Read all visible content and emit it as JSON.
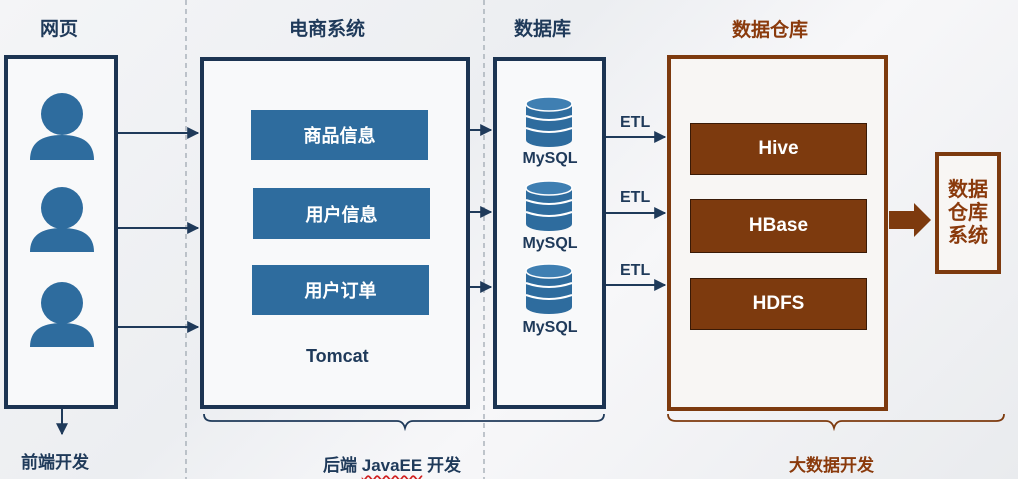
{
  "headings": {
    "webpage": "网页",
    "ecommerce": "电商系统",
    "database": "数据库",
    "warehouse": "数据仓库"
  },
  "ecommerce_items": [
    "商品信息",
    "用户信息",
    "用户订单"
  ],
  "server_label": "Tomcat",
  "databases": [
    "MySQL",
    "MySQL",
    "MySQL"
  ],
  "etl_labels": [
    "ETL",
    "ETL",
    "ETL"
  ],
  "warehouse_items": [
    "Hive",
    "HBase",
    "HDFS"
  ],
  "dw_system_lines": [
    "数据",
    "仓库",
    "系统"
  ],
  "footers": {
    "frontend": "前端开发",
    "backend_prefix": "后端 ",
    "backend_java": "JavaEE",
    "backend_suffix": " 开发",
    "bigdata": "大数据开发"
  },
  "colors": {
    "navy": "#1f3a5a",
    "blue": "#2e6c9e",
    "brown": "#7d3a0e"
  }
}
